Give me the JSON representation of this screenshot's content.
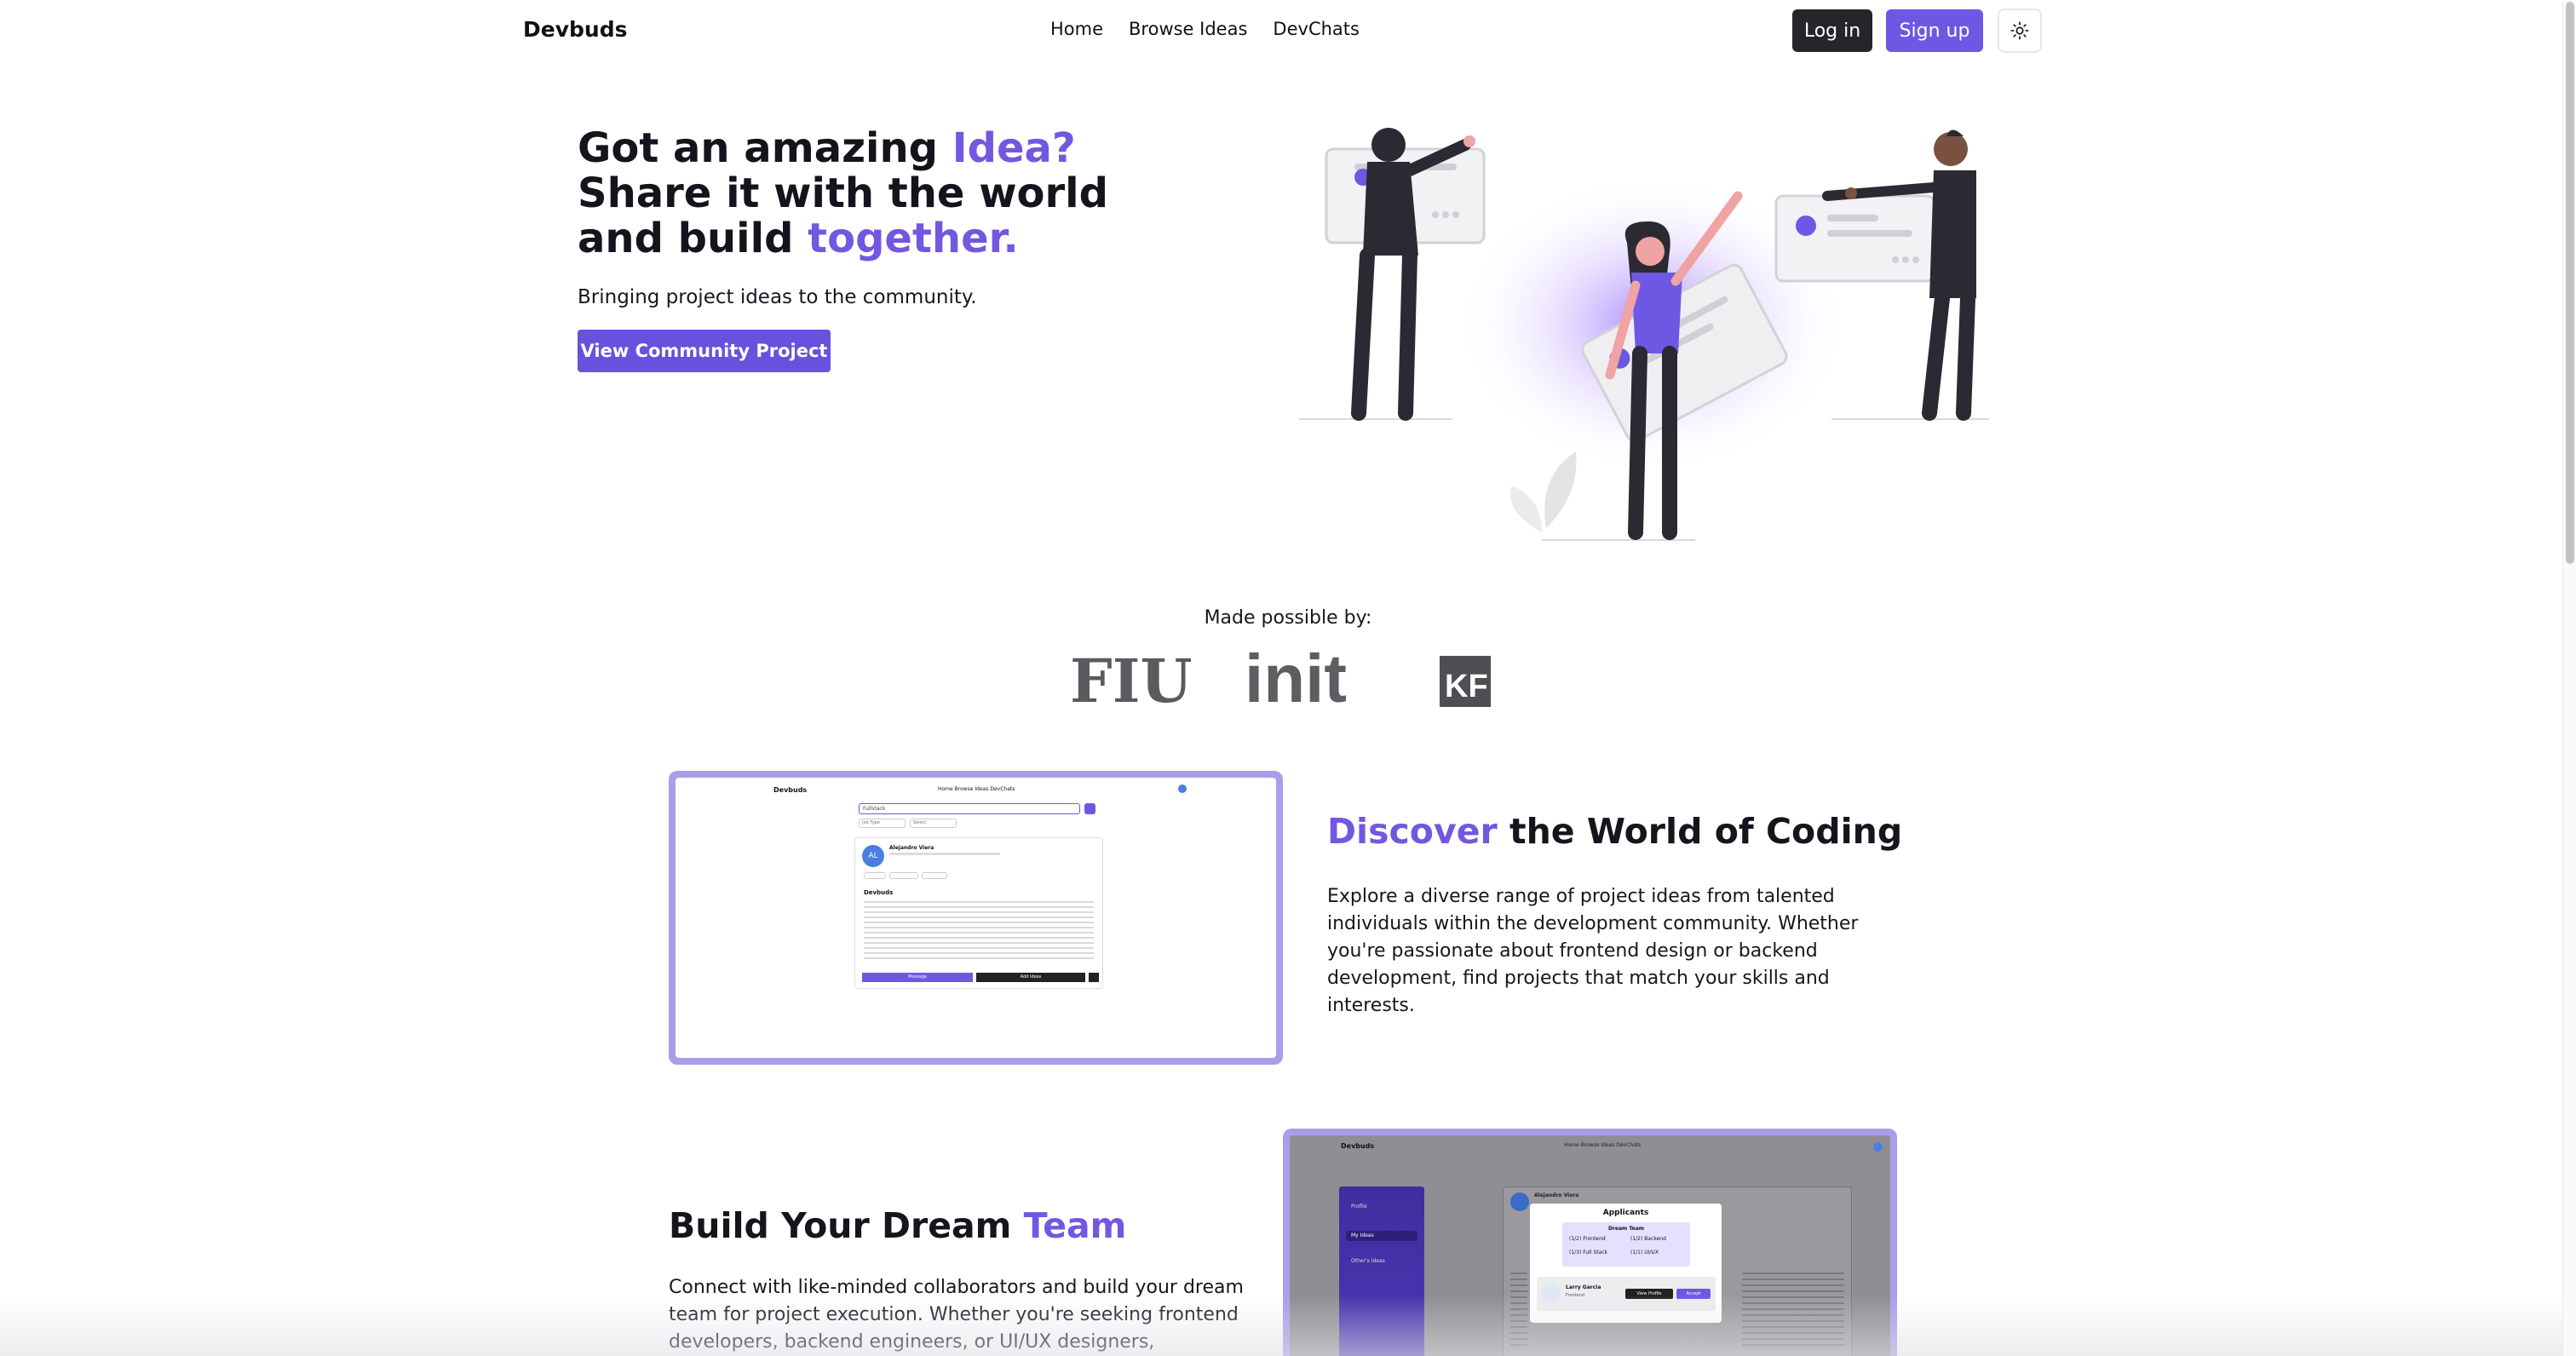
{
  "nav": {
    "brand": "Devbuds",
    "links": [
      "Home",
      "Browse Ideas",
      "DevChats"
    ],
    "login_label": "Log in",
    "signup_label": "Sign up",
    "theme_icon": "sun-icon"
  },
  "hero": {
    "line1_plain": "Got an amazing ",
    "line1_accent": "Idea?",
    "line2": "Share it with the world",
    "line3_plain": "and build ",
    "line3_accent": "together.",
    "subtitle": "Bringing project ideas to the community.",
    "cta_label": "View Community Project"
  },
  "sponsors": {
    "heading": "Made possible by:",
    "logos": [
      "FIU",
      "init",
      "KF"
    ]
  },
  "discover": {
    "title_accent": "Discover",
    "title_plain": " the World of Coding",
    "body": "Explore a diverse range of project ideas from talented individuals within the development community. Whether you're passionate about frontend design or backend development, find projects that match your skills and interests.",
    "preview": {
      "brand": "Devbuds",
      "nav": "Home  Browse Ideas  DevChats",
      "search_value": "Fullstack",
      "filter1": "Job Type",
      "filter2": "Select",
      "avatar": "AL",
      "author": "Alejandro Viera",
      "project_title": "Devbuds",
      "btn1": "Message",
      "btn2": "Add Ideas"
    }
  },
  "team": {
    "title_plain": "Build Your Dream ",
    "title_accent": "Team",
    "body": "Connect with like-minded collaborators and build your dream team for project execution. Whether you're seeking frontend developers, backend engineers, or UI/UX designers,",
    "preview": {
      "brand": "Devbuds",
      "nav": "Home  Browse Ideas  DevChats",
      "side1": "Profile",
      "side2": "My Ideas",
      "side3": "Other's Ideas",
      "author": "Alejandro Viera",
      "modal_title": "Applicants",
      "modal_sub": "Dream Team",
      "role1": "(1/2) Frontend",
      "role2": "(1/2) Backend",
      "role3": "(1/3) Full Stack",
      "role4": "(1/1) UI/UX",
      "applicant": "Larry Garcia",
      "applicant_role": "Frontend",
      "view_btn": "View Profile",
      "accept_btn": "Accept"
    }
  },
  "colors": {
    "accent": "#7258e0",
    "dark_button": "#262529",
    "frame": "#a99ee9"
  }
}
